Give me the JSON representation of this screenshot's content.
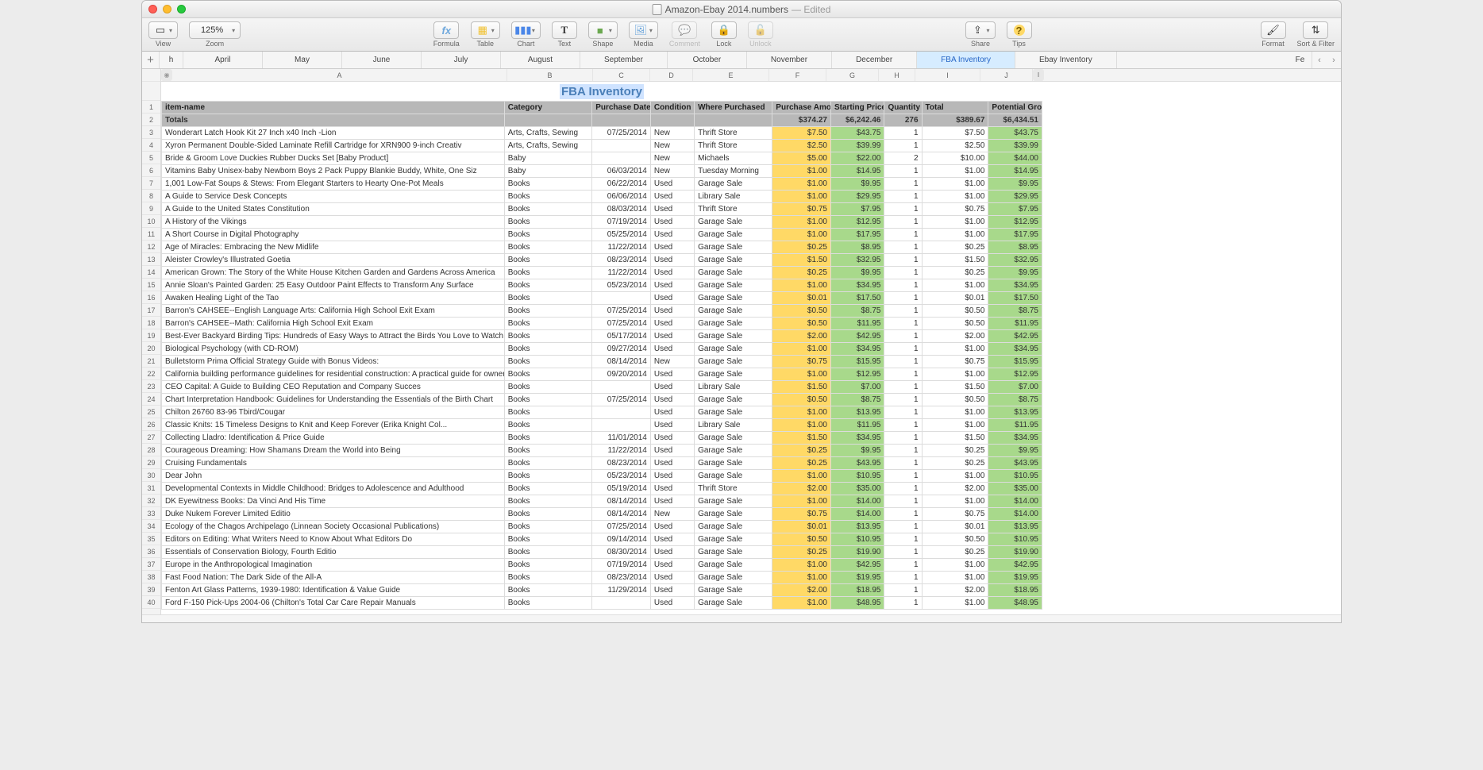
{
  "window": {
    "filename": "Amazon-Ebay 2014.numbers",
    "edited": "— Edited"
  },
  "toolbar": {
    "view": "View",
    "zoom": "Zoom",
    "zoom_value": "125%",
    "formula": "Formula",
    "table": "Table",
    "chart": "Chart",
    "text": "Text",
    "shape": "Shape",
    "media": "Media",
    "comment": "Comment",
    "lock": "Lock",
    "unlock": "Unlock",
    "share": "Share",
    "tips": "Tips",
    "format": "Format",
    "sortfilter": "Sort & Filter"
  },
  "tabs": {
    "partial_left": "h",
    "items": [
      "April",
      "May",
      "June",
      "July",
      "August",
      "September",
      "October",
      "November",
      "December",
      "FBA Inventory",
      "Ebay Inventory"
    ],
    "partial_right": "Fe",
    "active": "FBA Inventory"
  },
  "columns_letters": [
    "A",
    "B",
    "C",
    "D",
    "E",
    "F",
    "G",
    "H",
    "I",
    "J"
  ],
  "sheet_title": "FBA Inventory",
  "headers": [
    "item-name",
    "Category",
    "Purchase Date",
    "Condition",
    "Where Purchased",
    "Purchase Amount",
    "Starting Price",
    "Quantity",
    "Total",
    "Potential Gross"
  ],
  "totals": {
    "label": "Totals",
    "amount": "$374.27",
    "price": "$6,242.46",
    "qty": "276",
    "total": "$389.67",
    "gross": "$6,434.51"
  },
  "rows": [
    {
      "n": "Wonderart Latch Hook Kit 27 Inch x40 Inch -Lion",
      "c": "Arts, Crafts, Sewing",
      "d": "07/25/2014",
      "cd": "New",
      "w": "Thrift Store",
      "a": "$7.50",
      "p": "$43.75",
      "q": "1",
      "t": "$7.50",
      "g": "$43.75"
    },
    {
      "n": "Xyron Permanent Double-Sided Laminate Refill Cartridge for XRN900 9-inch Creativ",
      "c": "Arts, Crafts, Sewing",
      "d": "",
      "cd": "New",
      "w": "Thrift Store",
      "a": "$2.50",
      "p": "$39.99",
      "q": "1",
      "t": "$2.50",
      "g": "$39.99"
    },
    {
      "n": "Bride & Groom Love Duckies Rubber Ducks Set [Baby Product]",
      "c": "Baby",
      "d": "",
      "cd": "New",
      "w": "Michaels",
      "a": "$5.00",
      "p": "$22.00",
      "q": "2",
      "t": "$10.00",
      "g": "$44.00"
    },
    {
      "n": "Vitamins Baby Unisex-baby Newborn Boys 2 Pack Puppy Blankie Buddy, White, One Siz",
      "c": "Baby",
      "d": "06/03/2014",
      "cd": "New",
      "w": "Tuesday Morning",
      "a": "$1.00",
      "p": "$14.95",
      "q": "1",
      "t": "$1.00",
      "g": "$14.95"
    },
    {
      "n": "1,001 Low-Fat Soups & Stews: From Elegant Starters to Hearty One-Pot Meals",
      "c": "Books",
      "d": "06/22/2014",
      "cd": "Used",
      "w": "Garage Sale",
      "a": "$1.00",
      "p": "$9.95",
      "q": "1",
      "t": "$1.00",
      "g": "$9.95"
    },
    {
      "n": "A Guide to Service Desk Concepts",
      "c": "Books",
      "d": "06/06/2014",
      "cd": "Used",
      "w": "Library Sale",
      "a": "$1.00",
      "p": "$29.95",
      "q": "1",
      "t": "$1.00",
      "g": "$29.95"
    },
    {
      "n": "A Guide to the United States Constitution",
      "c": "Books",
      "d": "08/03/2014",
      "cd": "Used",
      "w": "Thrift Store",
      "a": "$0.75",
      "p": "$7.95",
      "q": "1",
      "t": "$0.75",
      "g": "$7.95"
    },
    {
      "n": "A History of the Vikings",
      "c": "Books",
      "d": "07/19/2014",
      "cd": "Used",
      "w": "Garage Sale",
      "a": "$1.00",
      "p": "$12.95",
      "q": "1",
      "t": "$1.00",
      "g": "$12.95"
    },
    {
      "n": "A Short Course in Digital Photography",
      "c": "Books",
      "d": "05/25/2014",
      "cd": "Used",
      "w": "Garage Sale",
      "a": "$1.00",
      "p": "$17.95",
      "q": "1",
      "t": "$1.00",
      "g": "$17.95"
    },
    {
      "n": "Age of Miracles: Embracing the New Midlife",
      "c": "Books",
      "d": "11/22/2014",
      "cd": "Used",
      "w": "Garage Sale",
      "a": "$0.25",
      "p": "$8.95",
      "q": "1",
      "t": "$0.25",
      "g": "$8.95"
    },
    {
      "n": "Aleister Crowley's Illustrated Goetia",
      "c": "Books",
      "d": "08/23/2014",
      "cd": "Used",
      "w": "Garage Sale",
      "a": "$1.50",
      "p": "$32.95",
      "q": "1",
      "t": "$1.50",
      "g": "$32.95"
    },
    {
      "n": "American Grown: The Story of the White House Kitchen Garden and Gardens Across America",
      "c": "Books",
      "d": "11/22/2014",
      "cd": "Used",
      "w": "Garage Sale",
      "a": "$0.25",
      "p": "$9.95",
      "q": "1",
      "t": "$0.25",
      "g": "$9.95"
    },
    {
      "n": "Annie Sloan's Painted Garden: 25 Easy Outdoor Paint Effects to Transform Any Surface",
      "c": "Books",
      "d": "05/23/2014",
      "cd": "Used",
      "w": "Garage Sale",
      "a": "$1.00",
      "p": "$34.95",
      "q": "1",
      "t": "$1.00",
      "g": "$34.95"
    },
    {
      "n": "Awaken Healing Light of the Tao",
      "c": "Books",
      "d": "",
      "cd": "Used",
      "w": "Garage Sale",
      "a": "$0.01",
      "p": "$17.50",
      "q": "1",
      "t": "$0.01",
      "g": "$17.50"
    },
    {
      "n": "Barron's CAHSEE--English Language Arts: California High School Exit Exam",
      "c": "Books",
      "d": "07/25/2014",
      "cd": "Used",
      "w": "Garage Sale",
      "a": "$0.50",
      "p": "$8.75",
      "q": "1",
      "t": "$0.50",
      "g": "$8.75"
    },
    {
      "n": "Barron's CAHSEE--Math: California High School Exit Exam",
      "c": "Books",
      "d": "07/25/2014",
      "cd": "Used",
      "w": "Garage Sale",
      "a": "$0.50",
      "p": "$11.95",
      "q": "1",
      "t": "$0.50",
      "g": "$11.95"
    },
    {
      "n": "Best-Ever Backyard Birding Tips: Hundreds of Easy Ways to Attract the Birds You Love to Watch",
      "c": "Books",
      "d": "05/17/2014",
      "cd": "Used",
      "w": "Garage Sale",
      "a": "$2.00",
      "p": "$42.95",
      "q": "1",
      "t": "$2.00",
      "g": "$42.95"
    },
    {
      "n": "Biological Psychology (with CD-ROM)",
      "c": "Books",
      "d": "09/27/2014",
      "cd": "Used",
      "w": "Garage Sale",
      "a": "$1.00",
      "p": "$34.95",
      "q": "1",
      "t": "$1.00",
      "g": "$34.95"
    },
    {
      "n": "Bulletstorm Prima Official Strategy Guide with Bonus Videos:",
      "c": "Books",
      "d": "08/14/2014",
      "cd": "New",
      "w": "Garage Sale",
      "a": "$0.75",
      "p": "$15.95",
      "q": "1",
      "t": "$0.75",
      "g": "$15.95"
    },
    {
      "n": "California building performance guidelines for residential construction: A practical guide for owners of new homes : constr",
      "c": "Books",
      "d": "09/20/2014",
      "cd": "Used",
      "w": "Garage Sale",
      "a": "$1.00",
      "p": "$12.95",
      "q": "1",
      "t": "$1.00",
      "g": "$12.95"
    },
    {
      "n": "CEO Capital: A Guide to Building CEO Reputation and Company Succes",
      "c": "Books",
      "d": "",
      "cd": "Used",
      "w": "Library Sale",
      "a": "$1.50",
      "p": "$7.00",
      "q": "1",
      "t": "$1.50",
      "g": "$7.00"
    },
    {
      "n": "Chart Interpretation Handbook: Guidelines for Understanding the Essentials of the Birth Chart",
      "c": "Books",
      "d": "07/25/2014",
      "cd": "Used",
      "w": "Garage Sale",
      "a": "$0.50",
      "p": "$8.75",
      "q": "1",
      "t": "$0.50",
      "g": "$8.75"
    },
    {
      "n": "Chilton 26760 83-96 Tbird/Cougar",
      "c": "Books",
      "d": "",
      "cd": "Used",
      "w": "Garage Sale",
      "a": "$1.00",
      "p": "$13.95",
      "q": "1",
      "t": "$1.00",
      "g": "$13.95"
    },
    {
      "n": "Classic Knits: 15 Timeless Designs to Knit and Keep Forever (Erika Knight Col...",
      "c": "Books",
      "d": "",
      "cd": "Used",
      "w": "Library Sale",
      "a": "$1.00",
      "p": "$11.95",
      "q": "1",
      "t": "$1.00",
      "g": "$11.95"
    },
    {
      "n": "Collecting Lladro: Identification & Price Guide",
      "c": "Books",
      "d": "11/01/2014",
      "cd": "Used",
      "w": "Garage Sale",
      "a": "$1.50",
      "p": "$34.95",
      "q": "1",
      "t": "$1.50",
      "g": "$34.95"
    },
    {
      "n": "Courageous Dreaming: How Shamans Dream the World into Being",
      "c": "Books",
      "d": "11/22/2014",
      "cd": "Used",
      "w": "Garage Sale",
      "a": "$0.25",
      "p": "$9.95",
      "q": "1",
      "t": "$0.25",
      "g": "$9.95"
    },
    {
      "n": "Cruising Fundamentals",
      "c": "Books",
      "d": "08/23/2014",
      "cd": "Used",
      "w": "Garage Sale",
      "a": "$0.25",
      "p": "$43.95",
      "q": "1",
      "t": "$0.25",
      "g": "$43.95"
    },
    {
      "n": "Dear John",
      "c": "Books",
      "d": "05/23/2014",
      "cd": "Used",
      "w": "Garage Sale",
      "a": "$1.00",
      "p": "$10.95",
      "q": "1",
      "t": "$1.00",
      "g": "$10.95"
    },
    {
      "n": "Developmental Contexts in Middle Childhood: Bridges to Adolescence and Adulthood",
      "c": "Books",
      "d": "05/19/2014",
      "cd": "Used",
      "w": "Thrift Store",
      "a": "$2.00",
      "p": "$35.00",
      "q": "1",
      "t": "$2.00",
      "g": "$35.00"
    },
    {
      "n": "DK Eyewitness Books: Da Vinci And His Time",
      "c": "Books",
      "d": "08/14/2014",
      "cd": "Used",
      "w": "Garage Sale",
      "a": "$1.00",
      "p": "$14.00",
      "q": "1",
      "t": "$1.00",
      "g": "$14.00"
    },
    {
      "n": "Duke Nukem Forever Limited Editio",
      "c": "Books",
      "d": "08/14/2014",
      "cd": "New",
      "w": "Garage Sale",
      "a": "$0.75",
      "p": "$14.00",
      "q": "1",
      "t": "$0.75",
      "g": "$14.00"
    },
    {
      "n": "Ecology of the Chagos Archipelago (Linnean Society Occasional Publications)",
      "c": "Books",
      "d": "07/25/2014",
      "cd": "Used",
      "w": "Garage Sale",
      "a": "$0.01",
      "p": "$13.95",
      "q": "1",
      "t": "$0.01",
      "g": "$13.95"
    },
    {
      "n": "Editors on Editing: What Writers Need to Know About What Editors Do",
      "c": "Books",
      "d": "09/14/2014",
      "cd": "Used",
      "w": "Garage Sale",
      "a": "$0.50",
      "p": "$10.95",
      "q": "1",
      "t": "$0.50",
      "g": "$10.95"
    },
    {
      "n": "Essentials of Conservation Biology, Fourth Editio",
      "c": "Books",
      "d": "08/30/2014",
      "cd": "Used",
      "w": "Garage Sale",
      "a": "$0.25",
      "p": "$19.90",
      "q": "1",
      "t": "$0.25",
      "g": "$19.90"
    },
    {
      "n": "Europe in the Anthropological Imagination",
      "c": "Books",
      "d": "07/19/2014",
      "cd": "Used",
      "w": "Garage Sale",
      "a": "$1.00",
      "p": "$42.95",
      "q": "1",
      "t": "$1.00",
      "g": "$42.95"
    },
    {
      "n": "Fast Food Nation: The Dark Side of the All-A",
      "c": "Books",
      "d": "08/23/2014",
      "cd": "Used",
      "w": "Garage Sale",
      "a": "$1.00",
      "p": "$19.95",
      "q": "1",
      "t": "$1.00",
      "g": "$19.95"
    },
    {
      "n": "Fenton Art Glass Patterns, 1939-1980: Identification & Value Guide",
      "c": "Books",
      "d": "11/29/2014",
      "cd": "Used",
      "w": "Garage Sale",
      "a": "$2.00",
      "p": "$18.95",
      "q": "1",
      "t": "$2.00",
      "g": "$18.95"
    },
    {
      "n": "Ford F-150 Pick-Ups 2004-06 (Chilton's Total Car Care Repair Manuals",
      "c": "Books",
      "d": "",
      "cd": "Used",
      "w": "Garage Sale",
      "a": "$1.00",
      "p": "$48.95",
      "q": "1",
      "t": "$1.00",
      "g": "$48.95"
    }
  ]
}
